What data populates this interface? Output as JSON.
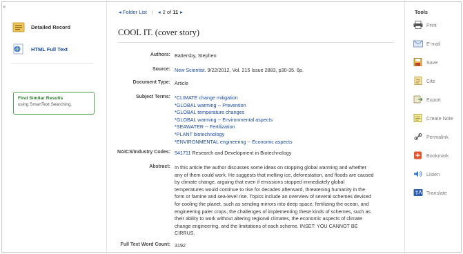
{
  "sidebar": {
    "collapse_glyph": "«",
    "detailed_record": "Detailed Record",
    "html_full_text": "HTML Full Text",
    "find_similar_title": "Find Similar Results",
    "find_similar_sub": "using SmartText Searching."
  },
  "nav": {
    "folder_list": "Folder List",
    "prev_glyph": "◂",
    "current": "2",
    "of": "of",
    "total": "11",
    "next_glyph": "▸"
  },
  "record": {
    "title": "COOL IT. (cover story)",
    "authors_label": "Authors:",
    "authors": "Battersby, Stephen",
    "source_label": "Source:",
    "source_link": "New Scientist",
    "source_detail": ". 9/22/2012, Vol. 215 Issue 2883, p30-35. 6p.",
    "doctype_label": "Document Type:",
    "doctype": "Article",
    "subject_label": "Subject Terms:",
    "subject_terms": [
      "*CLIMATE change mitigation",
      "*GLOBAL warming -- Prevention",
      "*GLOBAL temperature changes",
      "*GLOBAL warming -- Environmental aspects",
      "*SEAWATER -- Fertilization",
      "*PLANT biotechnology",
      "*ENVIRONMENTAL engineering -- Economic aspects"
    ],
    "naics_label": "NAICS/Industry Codes:",
    "naics_code": "541711",
    "naics_desc": "Research and Development in Biotechnology",
    "abstract_label": "Abstract:",
    "abstract": "In this article the author discusses some ideas on stopping global warming and whether any of them could work. He suggests that melting ice, deforestation, and floods are caused by climate change, arguing that even if emissions stopped immediately global temperatures would continue to rise for decades afterward, threatening humanity in the form or famine and sea-level rise. Topics include an overview of several schemes devised for cooling the planet, such as sending mirrors into deep space, fertilizing the ocean, and engineering paler crops, the challenges of implementing these kinds of schemes, such as their ability to work without altering regional climates, the economic aspects of climate change engineering, and the limitations of each scheme. INSET: YOU CANNOT BE CIRRUS.",
    "wordcount_label": "Full Text Word Count:",
    "wordcount": "3192"
  },
  "tools": {
    "heading": "Tools",
    "items": [
      {
        "label": "Print",
        "icon": "printer-icon"
      },
      {
        "label": "E-mail",
        "icon": "email-icon"
      },
      {
        "label": "Save",
        "icon": "save-icon"
      },
      {
        "label": "Cite",
        "icon": "cite-icon"
      },
      {
        "label": "Export",
        "icon": "export-icon"
      },
      {
        "label": "Create Note",
        "icon": "note-icon"
      },
      {
        "label": "Permalink",
        "icon": "permalink-icon"
      },
      {
        "label": "Bookmark",
        "icon": "bookmark-icon"
      },
      {
        "label": "Listen",
        "icon": "listen-icon"
      },
      {
        "label": "Translate",
        "icon": "translate-icon"
      }
    ]
  },
  "colors": {
    "link": "#1a4aa8",
    "similar_border": "#4da34d",
    "similar_title": "#2b7a2b",
    "bookmark": "#e8542a"
  }
}
